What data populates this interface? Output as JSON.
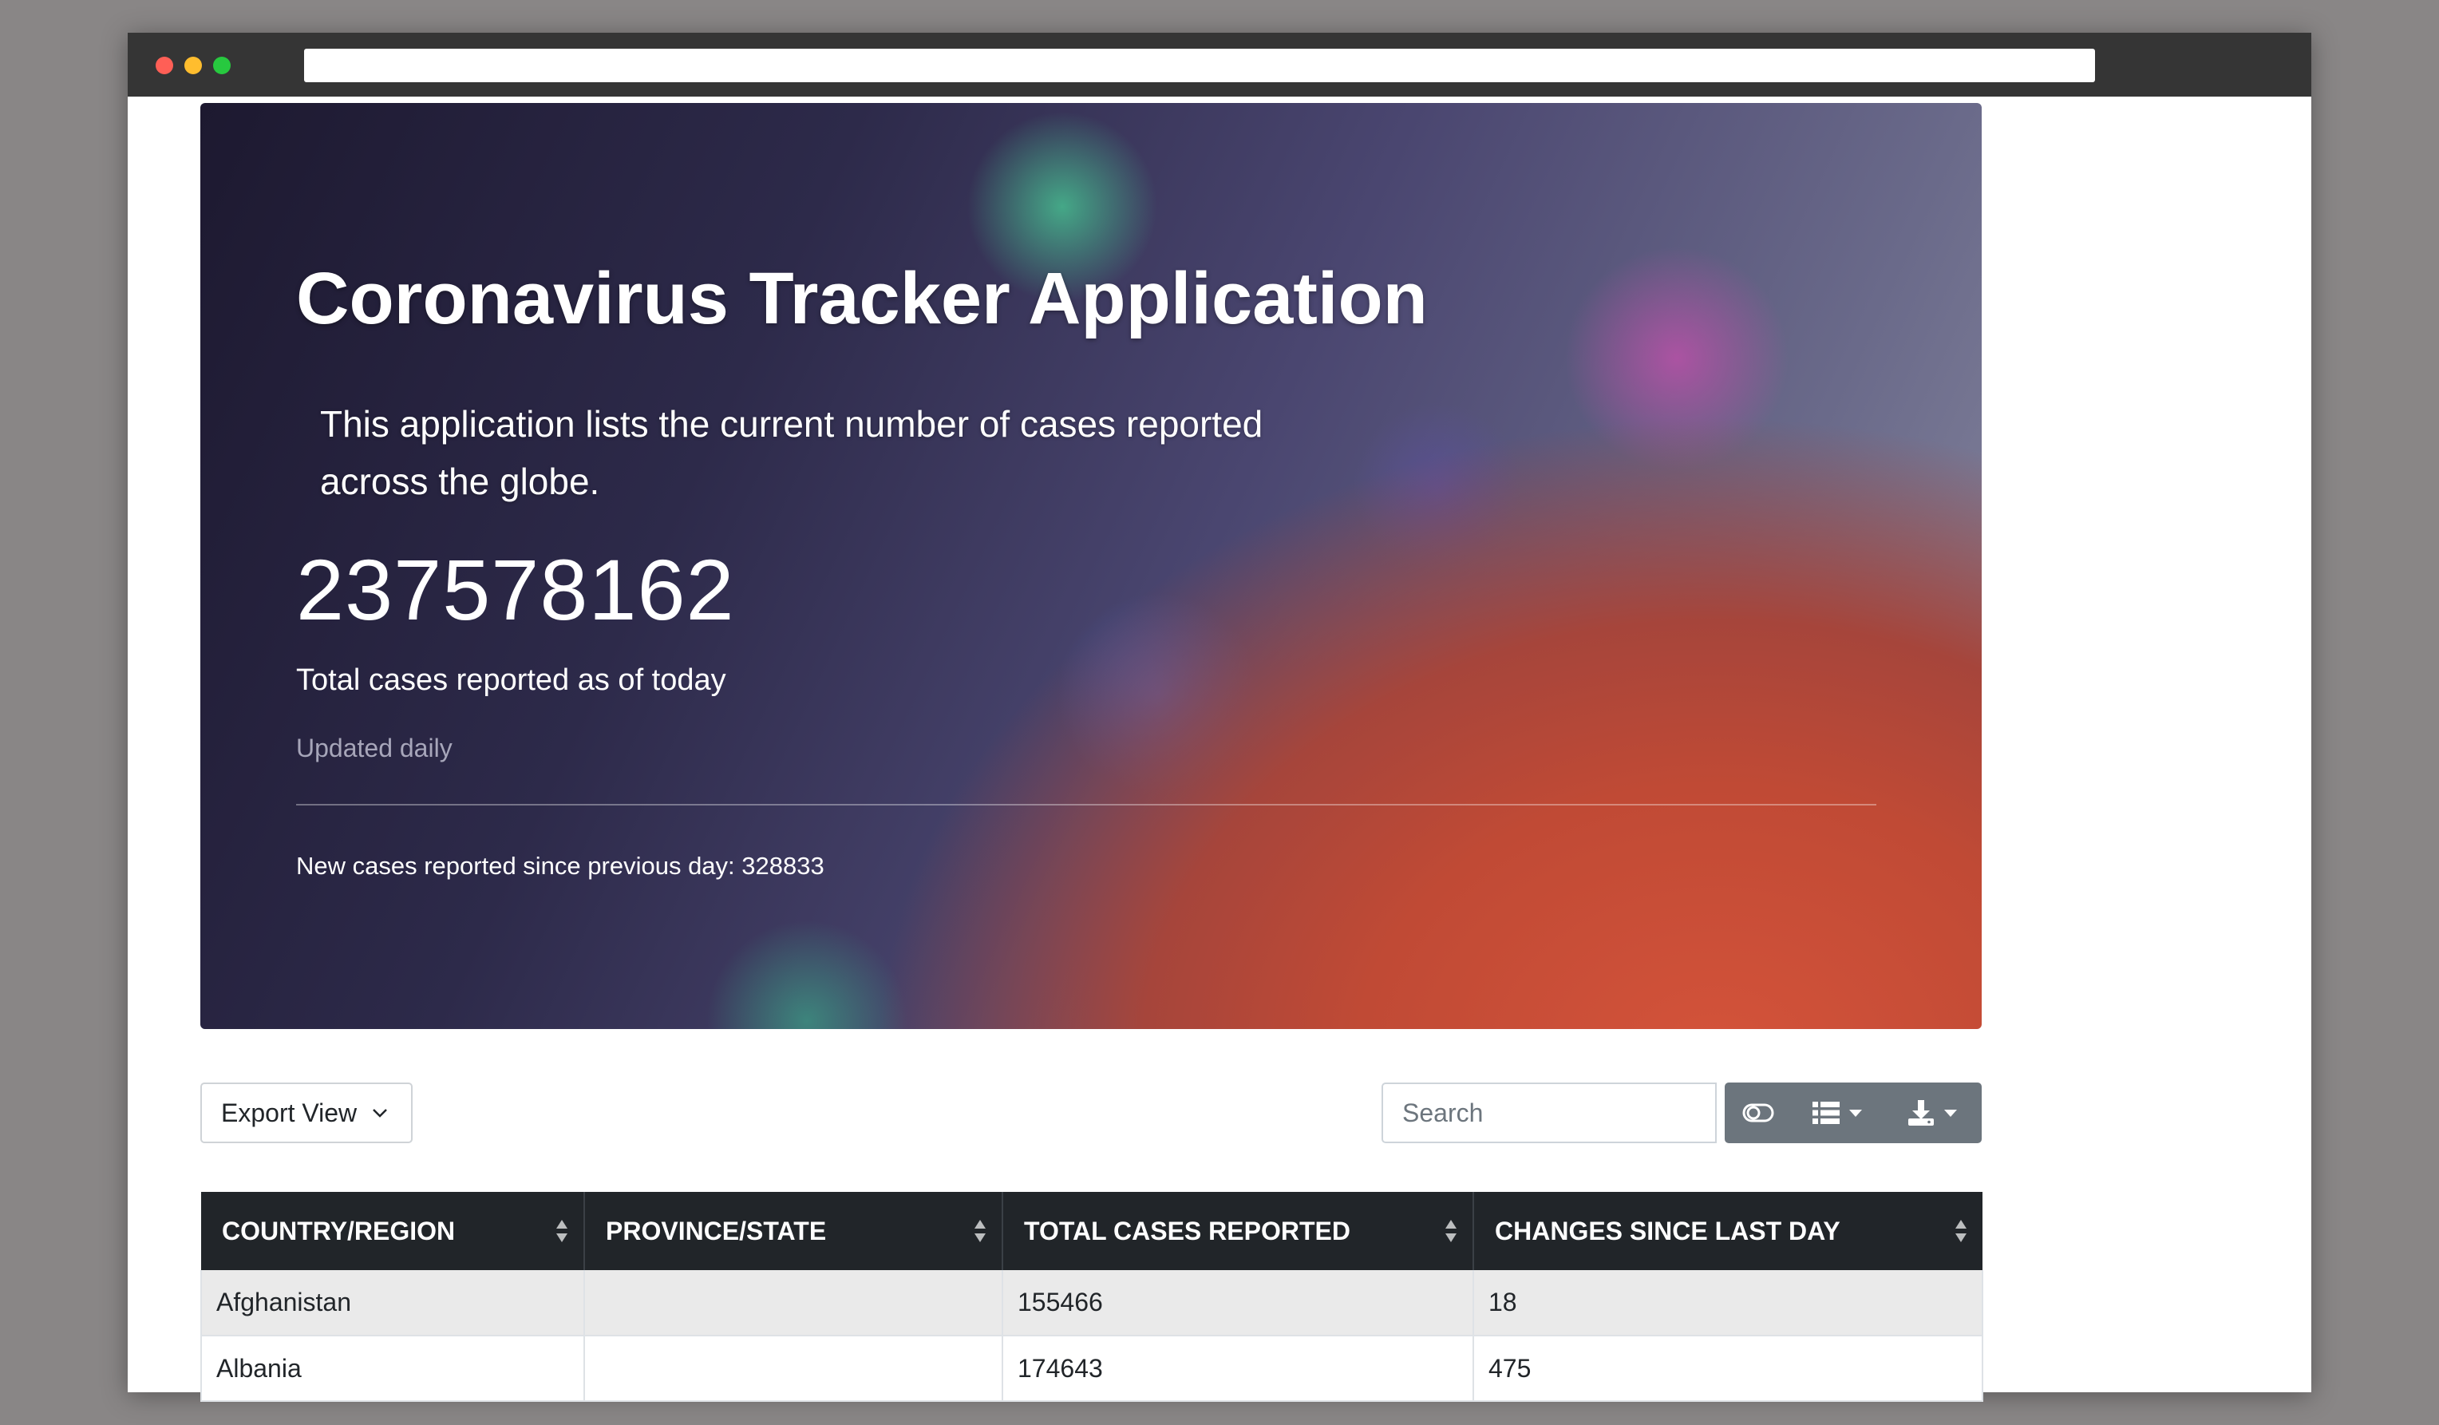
{
  "browser": {
    "url": ""
  },
  "hero": {
    "title": "Coronavirus Tracker Application",
    "lead": "This application lists the current number of cases reported across the globe.",
    "total_cases": "237578162",
    "total_label": "Total cases reported as of today",
    "updated": "Updated daily",
    "new_cases_text": "New cases reported since previous day: 328833"
  },
  "toolbar": {
    "export_label": "Export View",
    "search_placeholder": "Search",
    "icons": [
      "toggle-icon",
      "columns-icon",
      "download-icon"
    ]
  },
  "table": {
    "columns": [
      "COUNTRY/REGION",
      "PROVINCE/STATE",
      "TOTAL CASES REPORTED",
      "CHANGES SINCE LAST DAY"
    ],
    "rows": [
      [
        "Afghanistan",
        "",
        "155466",
        "18"
      ],
      [
        "Albania",
        "",
        "174643",
        "475"
      ]
    ]
  },
  "colors": {
    "header_bg": "#212529",
    "button_group": "#6c757d",
    "row_stripe": "#eaeaea"
  }
}
